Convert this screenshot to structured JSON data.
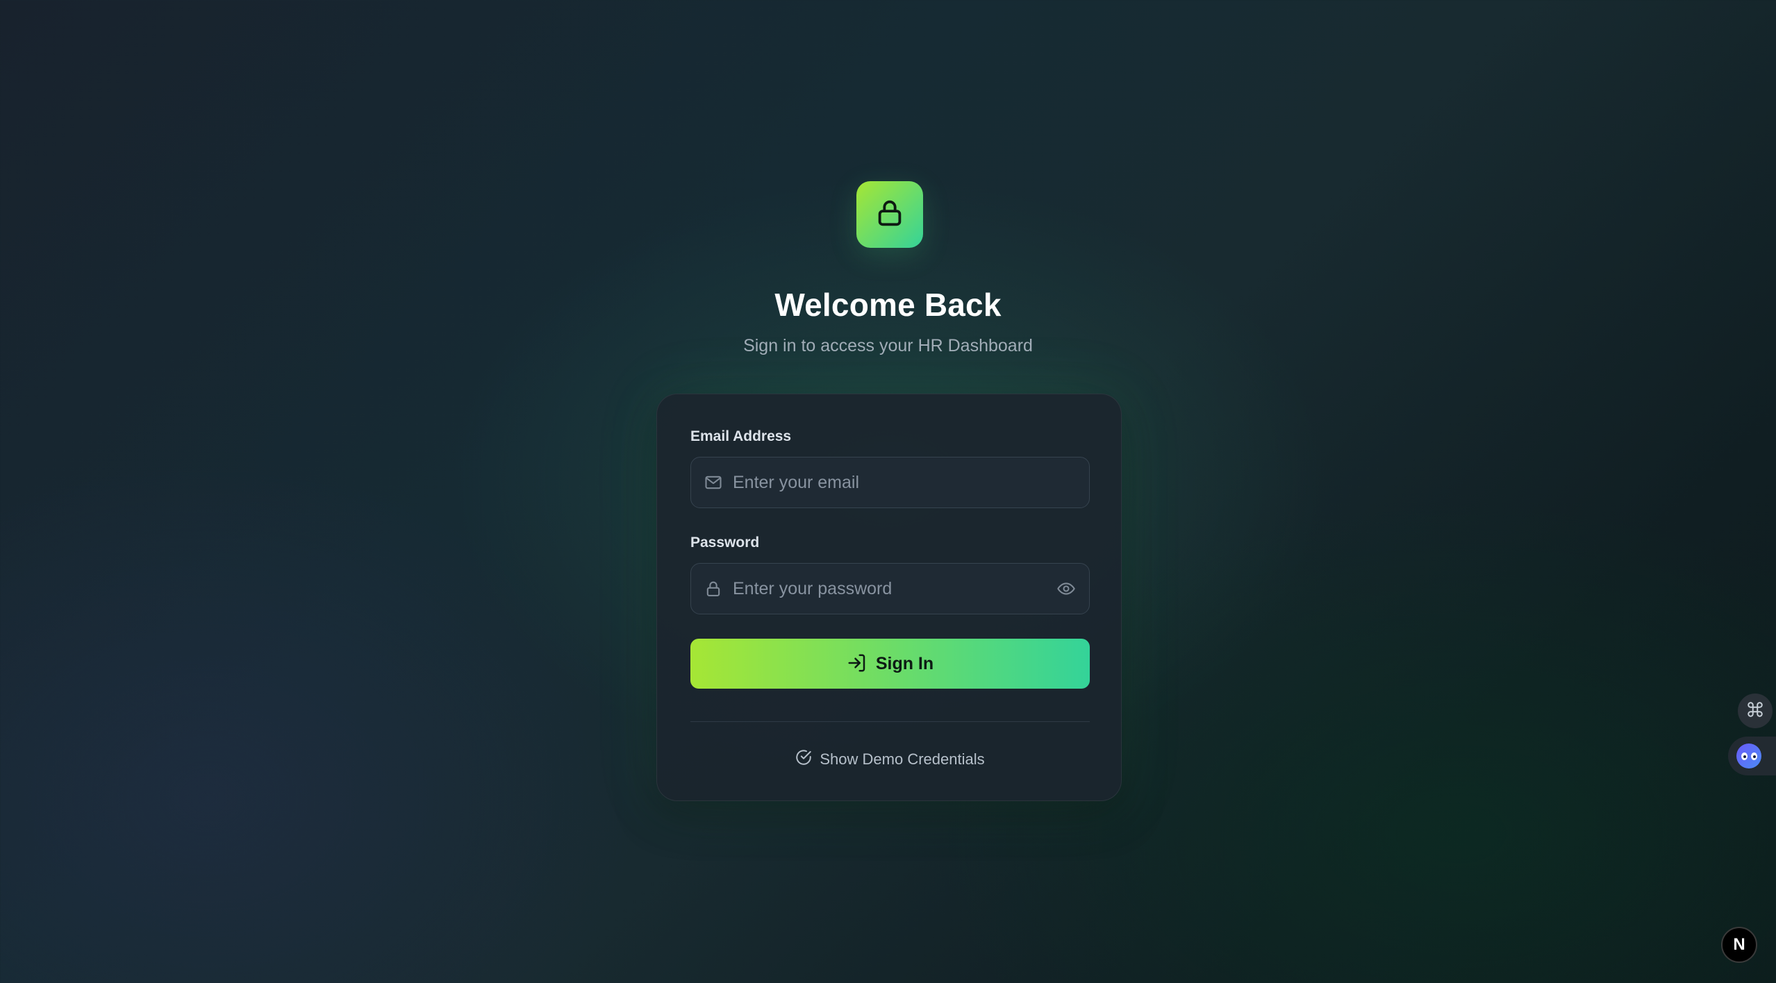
{
  "header": {
    "logo_icon": "lock-icon",
    "title": "Welcome Back",
    "subtitle": "Sign in to access your HR Dashboard"
  },
  "form": {
    "email": {
      "label": "Email Address",
      "placeholder": "Enter your email",
      "value": "",
      "icon": "mail-icon"
    },
    "password": {
      "label": "Password",
      "placeholder": "Enter your password",
      "value": "",
      "icon": "lock-icon",
      "toggle_icon": "eye-icon"
    },
    "submit_label": "Sign In",
    "submit_icon": "login-icon",
    "demo_label": "Show Demo Credentials",
    "demo_icon": "check-circle-icon"
  },
  "floating": {
    "command_icon": "command-icon",
    "assistant_icon": "assistant-face-icon",
    "badge_text": "N"
  },
  "colors": {
    "accent_start": "#a6e635",
    "accent_end": "#34d399",
    "card_bg": "#1b252e",
    "text_primary": "#ffffff",
    "text_muted": "#a2adb8"
  }
}
